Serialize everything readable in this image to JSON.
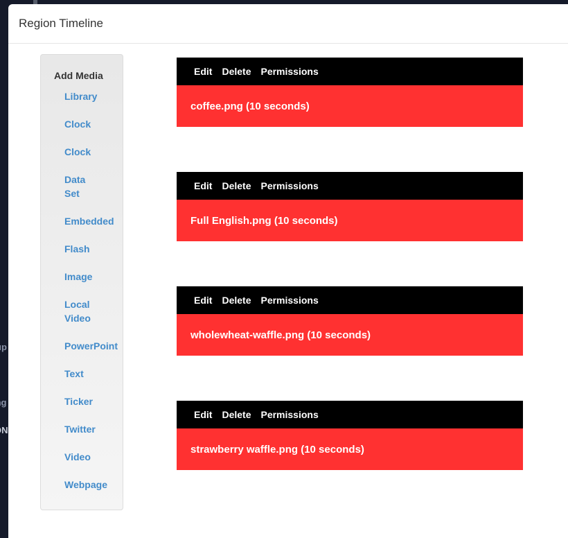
{
  "background_fragments": [
    "up",
    "ing",
    "ON"
  ],
  "modal": {
    "title": "Region Timeline"
  },
  "add_media": {
    "heading": "Add Media",
    "items": [
      "Library",
      "Clock",
      "Clock",
      "Data Set",
      "Embedded",
      "Flash",
      "Image",
      "Local Video",
      "PowerPoint",
      "Text",
      "Ticker",
      "Twitter",
      "Video",
      "Webpage"
    ]
  },
  "timeline": {
    "actions": {
      "edit": "Edit",
      "delete": "Delete",
      "permissions": "Permissions"
    },
    "items": [
      {
        "label": "coffee.png (10 seconds)"
      },
      {
        "label": "Full English.png (10 seconds)"
      },
      {
        "label": "wholewheat-waffle.png (10 seconds)"
      },
      {
        "label": "strawberry waffle.png (10 seconds)"
      }
    ]
  },
  "colors": {
    "accent": "#ff3131",
    "link": "#428bca",
    "bar": "#000000"
  }
}
